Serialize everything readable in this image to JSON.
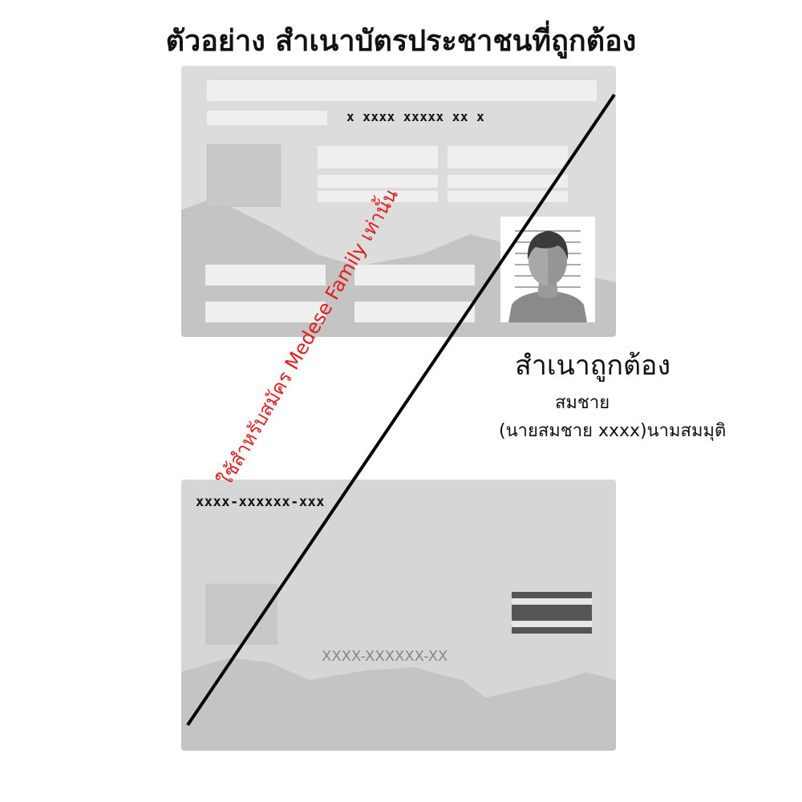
{
  "title": "ตัวอย่าง สำเนาบัตรประชาชนที่ถูกต้อง",
  "front_card": {
    "id_number": "x xxxx xxxxx xx x"
  },
  "back_card": {
    "laser_code": "xxxx-xxxxxx-xxx",
    "serial": "XXXX-XXXXXX-XX"
  },
  "certification": {
    "title": "สำเนาถูกต้อง",
    "signature": "สมชาย",
    "name_line": "(นายสมชาย xxxx)นามสมมุติ"
  },
  "watermark": "ใช้สำหรับสมัคร Medese Family เท่านั้น",
  "colors": {
    "watermark": "#e0201f",
    "card": "#dcdcdc",
    "flag_dark": "#555555",
    "flag_light": "#e6e6e6"
  }
}
